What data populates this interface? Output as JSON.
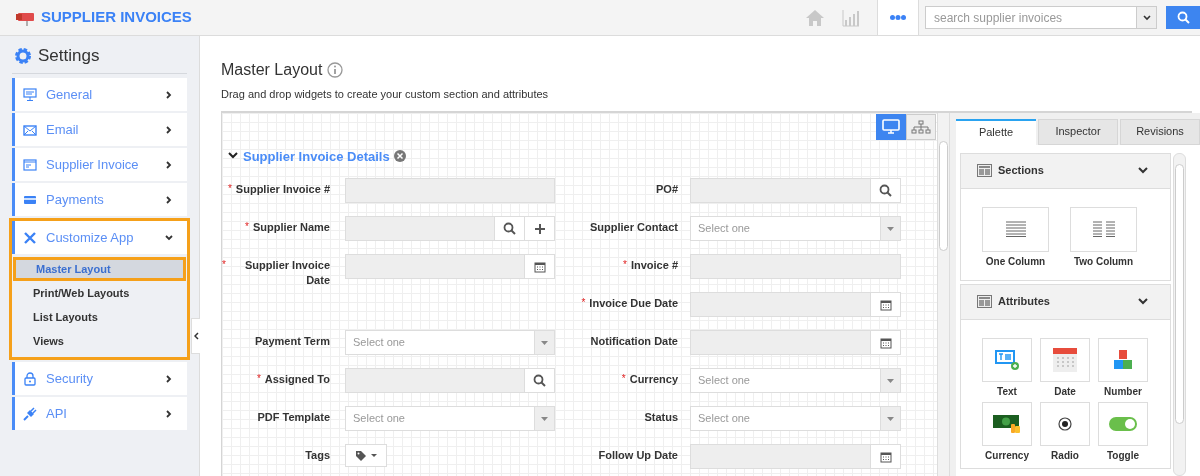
{
  "app": {
    "title": "SUPPLIER INVOICES",
    "search": {
      "placeholder": "search supplier invoices"
    }
  },
  "sidebar": {
    "title": "Settings",
    "items": [
      {
        "label": "General",
        "expanded": false
      },
      {
        "label": "Email",
        "expanded": false
      },
      {
        "label": "Supplier Invoice",
        "expanded": false
      },
      {
        "label": "Payments",
        "expanded": false
      },
      {
        "label": "Customize App",
        "expanded": true,
        "children": [
          {
            "label": "Master Layout",
            "selected": true
          },
          {
            "label": "Print/Web Layouts",
            "selected": false
          },
          {
            "label": "List Layouts",
            "selected": false
          },
          {
            "label": "Views",
            "selected": false
          }
        ]
      },
      {
        "label": "Security",
        "expanded": false
      },
      {
        "label": "API",
        "expanded": false
      }
    ]
  },
  "page": {
    "title": "Master Layout",
    "subtitle": "Drag and drop widgets to create your custom section and attributes"
  },
  "view_toggle": [
    {
      "kind": "desktop",
      "selected": true
    },
    {
      "kind": "tree",
      "selected": false
    }
  ],
  "section": {
    "title": "Supplier Invoice Details",
    "expanded": true,
    "rows": [
      {
        "left": {
          "label": "Supplier Invoice #",
          "required_mark": "*",
          "kind": "text"
        },
        "right": {
          "label": "PO#",
          "kind": "search"
        }
      },
      {
        "left": {
          "label": "Supplier Name",
          "required_mark": "*",
          "kind": "search_add"
        },
        "right": {
          "label": "Supplier Contact",
          "kind": "select",
          "placeholder": "Select one"
        }
      },
      {
        "left": {
          "label": "Supplier Invoice Date",
          "required_mark": "*",
          "kind": "date"
        },
        "right": {
          "label": "Invoice #",
          "required_mark": "*",
          "kind": "text"
        }
      },
      {
        "right": {
          "label": "Invoice Due Date",
          "required_mark": "*",
          "kind": "date"
        }
      },
      {
        "left": {
          "label": "Payment Term",
          "kind": "select",
          "placeholder": "Select one"
        },
        "right": {
          "label": "Notification Date",
          "kind": "date"
        }
      },
      {
        "left": {
          "label": "Assigned To",
          "required_mark": "*",
          "kind": "search"
        },
        "right": {
          "label": "Currency",
          "required_mark": "*",
          "kind": "select",
          "placeholder": "Select one"
        }
      },
      {
        "left": {
          "label": "PDF Template",
          "kind": "select",
          "placeholder": "Select one"
        },
        "right": {
          "label": "Status",
          "kind": "select",
          "placeholder": "Select one"
        }
      },
      {
        "left": {
          "label": "Tags",
          "kind": "tags"
        },
        "right": {
          "label": "Follow Up Date",
          "kind": "date"
        }
      }
    ]
  },
  "panel": {
    "tabs": [
      {
        "label": "Palette",
        "selected": true
      },
      {
        "label": "Inspector",
        "selected": false
      },
      {
        "label": "Revisions",
        "selected": false
      }
    ],
    "groups": [
      {
        "title": "Sections",
        "expanded": true,
        "items": [
          {
            "label": "One Column",
            "kind": "one_column"
          },
          {
            "label": "Two Column",
            "kind": "two_column"
          }
        ]
      },
      {
        "title": "Attributes",
        "expanded": true,
        "items": [
          {
            "label": "Text",
            "kind": "text"
          },
          {
            "label": "Date",
            "kind": "date"
          },
          {
            "label": "Number",
            "kind": "number"
          },
          {
            "label": "Currency",
            "kind": "currency"
          },
          {
            "label": "Radio",
            "kind": "radio"
          },
          {
            "label": "Toggle",
            "kind": "toggle"
          }
        ]
      }
    ]
  }
}
